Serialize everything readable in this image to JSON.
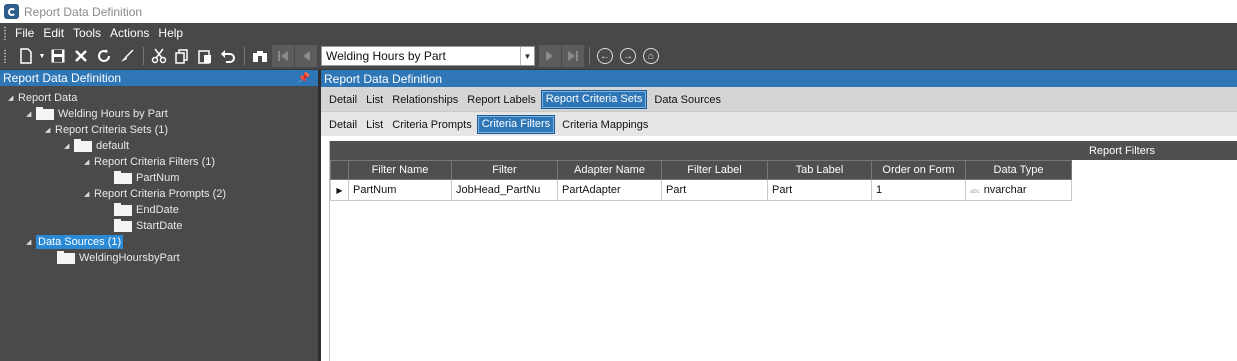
{
  "window": {
    "title": "Report Data Definition"
  },
  "menu": [
    "File",
    "Edit",
    "Tools",
    "Actions",
    "Help"
  ],
  "toolbar": {
    "combo_value": "Welding Hours by Part"
  },
  "left_panel": {
    "title": "Report Data Definition",
    "tree": [
      {
        "label": "Report Data"
      },
      {
        "label": "Welding Hours by Part"
      },
      {
        "label": "Report Criteria Sets (1)"
      },
      {
        "label": "default"
      },
      {
        "label": "Report Criteria Filters (1)"
      },
      {
        "label": "PartNum"
      },
      {
        "label": "Report Criteria Prompts (2)"
      },
      {
        "label": "EndDate"
      },
      {
        "label": "StartDate"
      },
      {
        "label": "Data Sources (1)"
      },
      {
        "label": "WeldingHoursbyPart"
      }
    ]
  },
  "right_panel": {
    "title": "Report Data Definition",
    "tabs1": [
      "Detail",
      "List",
      "Relationships",
      "Report Labels",
      "Report Criteria Sets",
      "Data Sources"
    ],
    "tabs2": [
      "Detail",
      "List",
      "Criteria Prompts",
      "Criteria Filters",
      "Criteria Mappings"
    ],
    "grid": {
      "title": "Report Filters",
      "columns": [
        "Filter Name",
        "Filter",
        "Adapter Name",
        "Filter Label",
        "Tab Label",
        "Order on Form",
        "Data Type"
      ],
      "rows": [
        [
          "PartNum",
          "JobHead_PartNu",
          "PartAdapter",
          "Part",
          "Part",
          "1",
          "nvarchar"
        ]
      ]
    }
  },
  "colors": {
    "accent": "#2e76b6",
    "selection": "#2a8ad6",
    "dark_panel": "#4a4a4a"
  }
}
